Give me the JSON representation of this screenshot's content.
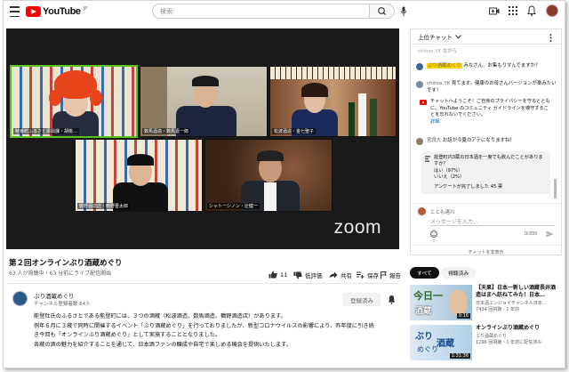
{
  "header": {
    "logo_text": "YouTube",
    "logo_region": "JP",
    "search_placeholder": "検索"
  },
  "video": {
    "participants": [
      "鮭番町ふるさと振興課・胡桃…",
      "数馬酒造・数馬嘉一郎",
      "松波酒造・金七聖子",
      "鶴野酒造店・鶴野晋太郎",
      "シャトーシノン・辻健一"
    ],
    "zoom_logo": "zoom",
    "title": "第２回オンラインぶり酒蔵めぐり",
    "stats": "63 人が視聴中・63 分前にライブ配信開始",
    "like_count": "11",
    "dislike_label": "低評価",
    "share_label": "共有",
    "save_label": "保存",
    "report_label": "報告"
  },
  "channel": {
    "name": "ぶり酒蔵めぐり",
    "subscribers": "チャンネル登録者数 64人",
    "subscribe_label": "登録済み"
  },
  "description": [
    "能登杜氏のふるさとである能登町には、３つの酒蔵（松波酒造、数馬酒造、鶴野酒造店）があります。",
    "例年６月に３蔵で同時に開催するイベント「ぶり酒蔵めぐり」を行っておりましたが、新型コロナウイルスの影響により、昨年度に引き続き今回も「オンラインぶり酒蔵めぐり」として実施することとなりました。",
    "各蔵の酒の魅力を紹介することを通じて、日本酒ファンの醸成や自宅で楽しめる機会を提供いたします。"
  ],
  "chat": {
    "header": "上位チャット",
    "messages": [
      {
        "author": "chiitos.YK",
        "text": "ながら"
      },
      {
        "author": "ぶり酒蔵めぐり",
        "text": "みなさん、お集もりすんでますか？",
        "highlight": true
      },
      {
        "author": "chiitos.YK",
        "text": "見てます。健康のお母さんバージョンが楽みたいです！"
      }
    ],
    "notice": "チャットへようこそ！ご自身のプライバシーを守るとともに、YouTube のコミュニティ ガイドラインを遵守することを忘れないでください。",
    "notice_link": "詳細",
    "msg4_author": "宮良大",
    "msg4_text": "お話が今夏のアテになりますね！",
    "poll": {
      "question": "能登町内3蔵の日本酒を一度でも飲んだことがありますか？",
      "options": [
        "はい（97%）",
        "いいえ（2%）"
      ],
      "result": "アンケートが完了しました 45 票"
    },
    "input_user": "ととも達川",
    "input_placeholder": "メッセージを入力...",
    "char_count": "0/200",
    "hide_chat": "チャットを非表示"
  },
  "tabs": [
    "すべて",
    "視聴済み"
  ],
  "recommendations": [
    {
      "title": "【天果】日本一新しい酒蔵長井酒造はまへ訪ねてみた！日本…",
      "channel": "日本酒エンジョイチャンネル日本…",
      "meta": "7434 回視聴・1 年前",
      "duration": "9:16"
    },
    {
      "title": "オンラインぶり酒蔵めぐり",
      "channel": "ぶり酒蔵めぐり",
      "meta": "1296 回視聴・1 年前に配信済み",
      "duration": "1:31:36"
    }
  ]
}
